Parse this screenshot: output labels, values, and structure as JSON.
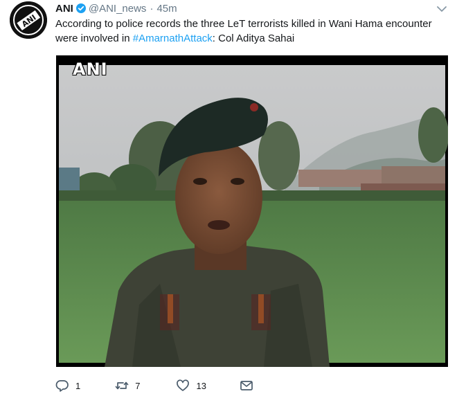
{
  "tweet": {
    "author_name": "ANI",
    "handle": "@ANI_news",
    "separator": "·",
    "time": "45m",
    "text_before": "According to police records the three LeT terrorists killed in Wani Hama encounter were involved in ",
    "hashtag": "#AmarnathAttack",
    "text_after": ": Col Aditya Sahai",
    "avatar_logo": "ANI",
    "media_watermark": "ANI"
  },
  "actions": {
    "replies": "1",
    "retweets": "7",
    "likes": "13"
  },
  "icons": {
    "verified": "verified-badge-icon",
    "caret": "chevron-down-icon",
    "reply": "reply-icon",
    "retweet": "retweet-icon",
    "like": "heart-icon",
    "dm": "envelope-icon"
  },
  "colors": {
    "accent": "#1da1f2",
    "secondary_text": "#657786",
    "primary_text": "#14171a"
  }
}
